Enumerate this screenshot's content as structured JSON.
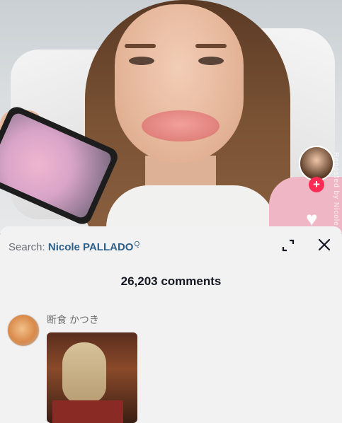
{
  "search": {
    "label": "Search:",
    "term": "Nicole PALLADO",
    "icon": "search-icon"
  },
  "comments": {
    "count_label": "26,203 comments"
  },
  "comment_list": [
    {
      "username": "断食 かつき",
      "has_image": true
    }
  ],
  "sidebar": {
    "follow_label": "+",
    "heart_icon": "♥"
  },
  "overlay": {
    "watermark": "Reposted by Nicole"
  },
  "colors": {
    "accent": "#fe2c55",
    "link": "#2c5f8a",
    "sheet_bg": "#f2f2f2"
  }
}
